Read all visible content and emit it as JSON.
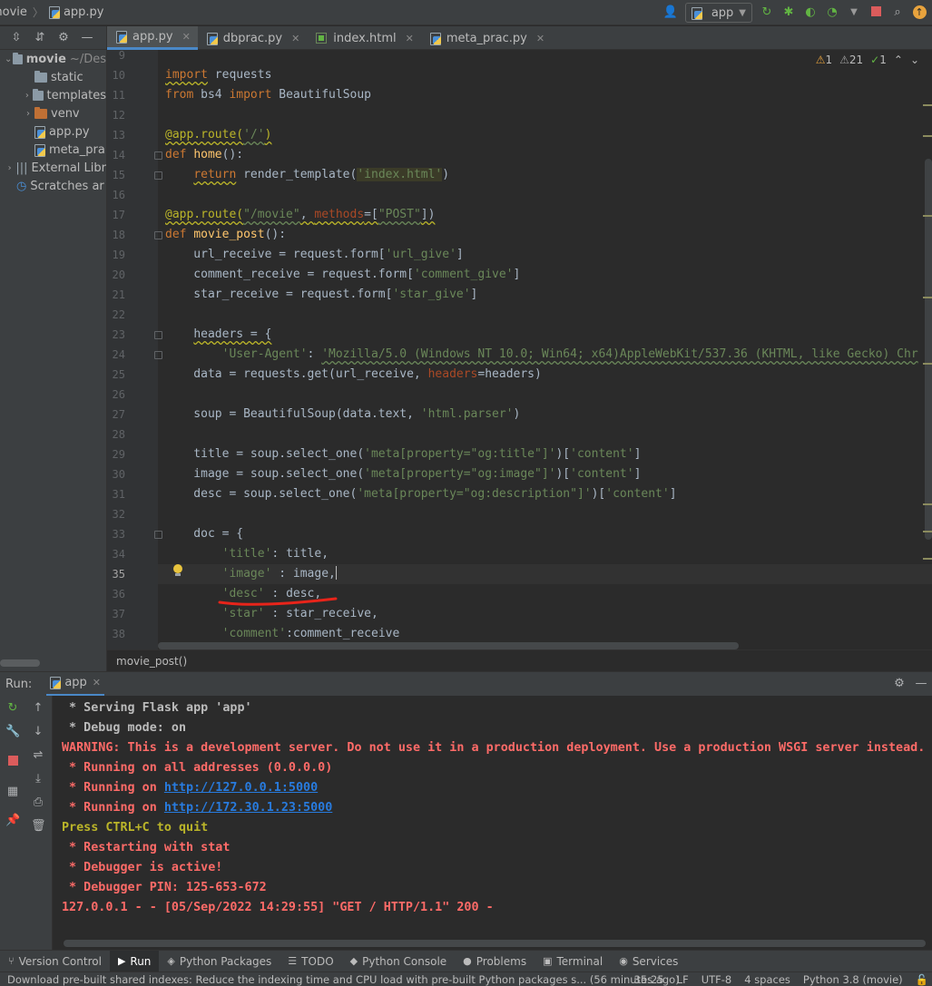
{
  "navbar": {
    "project": "movie",
    "file": "app.py",
    "run_config": "app"
  },
  "project_tree": [
    {
      "label": "movie",
      "suffix": "~/Des",
      "type": "folder",
      "level": 0,
      "expanded": true,
      "bold": true
    },
    {
      "label": "static",
      "type": "folder",
      "level": 1
    },
    {
      "label": "templates",
      "type": "folder",
      "level": 1,
      "collapsed": true
    },
    {
      "label": "venv",
      "type": "folder-orange",
      "level": 1,
      "collapsed": true
    },
    {
      "label": "app.py",
      "type": "py",
      "level": 1
    },
    {
      "label": "meta_pra",
      "type": "py",
      "level": 1
    },
    {
      "label": "External Libr",
      "type": "lib",
      "level": 0,
      "collapsed": true
    },
    {
      "label": "Scratches ar",
      "type": "scratch",
      "level": 0
    }
  ],
  "tabs": [
    {
      "label": "app.py",
      "type": "py",
      "active": true
    },
    {
      "label": "dbprac.py",
      "type": "py"
    },
    {
      "label": "index.html",
      "type": "html"
    },
    {
      "label": "meta_prac.py",
      "type": "py"
    }
  ],
  "inspections": {
    "warnings": "1",
    "weak": "21",
    "ok": "1"
  },
  "code_lines": [
    {
      "n": "9",
      "html": ""
    },
    {
      "n": "10",
      "html": "<span class='kw wavy'>import</span> requests"
    },
    {
      "n": "11",
      "html": "<span class='kw'>from</span> bs4 <span class='kw'>import</span> BeautifulSoup"
    },
    {
      "n": "12",
      "html": ""
    },
    {
      "n": "13",
      "html": "<span class='dec wavy'>@app.route(</span><span class='str wavyg'>'/'</span><span class='dec wavy'>)</span>"
    },
    {
      "n": "14",
      "html": "<span class='kw'>def</span> <span class='fn'>home</span>():"
    },
    {
      "n": "15",
      "html": "    <span class='kw wavy'>return</span> render_template(<span class='str hlstr'>'index.html'</span>)"
    },
    {
      "n": "16",
      "html": ""
    },
    {
      "n": "17",
      "html": "<span class='dec wavy'>@app.route(</span><span class='str wavyg'>\"/movie\"</span><span class='wavy'>, </span><span class='param wavy'>methods</span><span class='wavy'>=[</span><span class='str wavyg'>\"POST\"</span><span class='wavy'>])</span>"
    },
    {
      "n": "18",
      "html": "<span class='kw'>def</span> <span class='fn'>movie_post</span>():"
    },
    {
      "n": "19",
      "html": "    url_receive = request.form[<span class='str'>'url_give'</span>]"
    },
    {
      "n": "20",
      "html": "    comment_receive = request.form[<span class='str'>'comment_give'</span>]"
    },
    {
      "n": "21",
      "html": "    star_receive = request.form[<span class='str'>'star_give'</span>]"
    },
    {
      "n": "22",
      "html": ""
    },
    {
      "n": "23",
      "html": "    <span class='wavy'>headers = {</span>"
    },
    {
      "n": "24",
      "html": "        <span class='str'>'User-Agent'</span>: <span class='str wavyg'>'Mozilla/5.0 (Windows NT 10.0; Win64; x64)AppleWebKit/537.36 (KHTML, like Gecko) Chr</span>"
    },
    {
      "n": "25",
      "html": "    data = requests.get(url_receive, <span class='param'>headers</span>=headers)"
    },
    {
      "n": "26",
      "html": ""
    },
    {
      "n": "27",
      "html": "    soup = BeautifulSoup(data.text, <span class='str'>'html.parser'</span>)"
    },
    {
      "n": "28",
      "html": ""
    },
    {
      "n": "29",
      "html": "    title = soup.select_one(<span class='str'>'meta[property=\"og:title\"]'</span>)[<span class='str'>'content'</span>]"
    },
    {
      "n": "30",
      "html": "    image = soup.select_one(<span class='str'>'meta[property=\"og:image\"]'</span>)[<span class='str'>'content'</span>]"
    },
    {
      "n": "31",
      "html": "    desc = soup.select_one(<span class='str'>'meta[property=\"og:description\"]'</span>)[<span class='str'>'content'</span>]"
    },
    {
      "n": "32",
      "html": ""
    },
    {
      "n": "33",
      "html": "    doc = {"
    },
    {
      "n": "34",
      "html": "        <span class='str'>'title'</span>: title,"
    },
    {
      "n": "35",
      "html": "        <span class='str'>'image'</span> : image,",
      "current": true
    },
    {
      "n": "36",
      "html": "        <span class='str'>'desc'</span> : desc,"
    },
    {
      "n": "37",
      "html": "        <span class='str'>'star'</span> : star_receive,"
    },
    {
      "n": "38",
      "html": "        <span class='str'>'comment'</span>:comment_receive"
    }
  ],
  "breadcrumb": {
    "function": "movie_post()"
  },
  "run": {
    "label": "Run:",
    "tab": "app"
  },
  "console_lines": [
    {
      "cls": "white",
      "text": " * Serving Flask app 'app'"
    },
    {
      "cls": "white",
      "text": " * Debug mode: on"
    },
    {
      "cls": "red",
      "text": "WARNING: This is a development server. Do not use it in a production deployment. Use a production WSGI server instead."
    },
    {
      "cls": "red",
      "text": " * Running on all addresses (0.0.0.0)"
    },
    {
      "cls": "red",
      "text": " * Running on ",
      "link": "http://127.0.0.1:5000"
    },
    {
      "cls": "red",
      "text": " * Running on ",
      "link": "http://172.30.1.23:5000"
    },
    {
      "cls": "yellow",
      "text": "Press CTRL+C to quit"
    },
    {
      "cls": "red",
      "text": " * Restarting with stat"
    },
    {
      "cls": "red",
      "text": " * Debugger is active!"
    },
    {
      "cls": "red",
      "text": " * Debugger PIN: 125-653-672"
    },
    {
      "cls": "red",
      "text": "127.0.0.1 - - [05/Sep/2022 14:29:55] \"GET / HTTP/1.1\" 200 -"
    }
  ],
  "tool_windows": [
    {
      "label": "Version Control",
      "icon": "branch-icon",
      "glyph": "⑂"
    },
    {
      "label": "Run",
      "icon": "play-icon",
      "glyph": "▶",
      "active": true
    },
    {
      "label": "Python Packages",
      "icon": "packages-icon",
      "glyph": "◈"
    },
    {
      "label": "TODO",
      "icon": "list-icon",
      "glyph": "☰"
    },
    {
      "label": "Python Console",
      "icon": "python-icon",
      "glyph": "◆"
    },
    {
      "label": "Problems",
      "icon": "info-icon",
      "glyph": "●"
    },
    {
      "label": "Terminal",
      "icon": "terminal-icon",
      "glyph": "▣"
    },
    {
      "label": "Services",
      "icon": "services-icon",
      "glyph": "◉"
    }
  ],
  "status": {
    "message": "Download pre-built shared indexes: Reduce the indexing time and CPU load with pre-built Python packages s... (56 minutes ago)",
    "position": "35:25",
    "line_ending": "LF",
    "encoding": "UTF-8",
    "indent": "4 spaces",
    "interpreter": "Python 3.8 (movie)"
  },
  "colors": {
    "accent": "#4a88c7",
    "error": "#ff6b68",
    "link": "#287bde"
  }
}
